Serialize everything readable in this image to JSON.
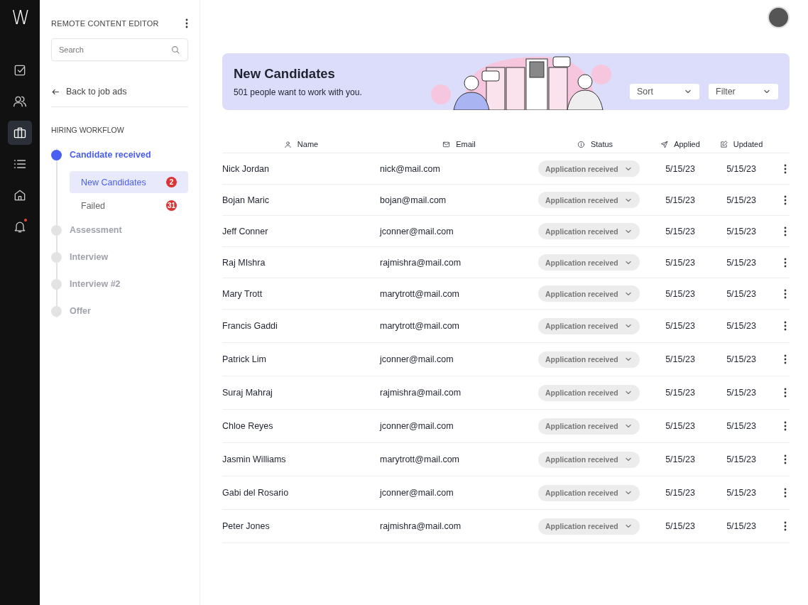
{
  "rail": {
    "logo": "W",
    "items": [
      {
        "kind": "task",
        "selected": false,
        "unread": false
      },
      {
        "kind": "users",
        "selected": false,
        "unread": false
      },
      {
        "kind": "briefcase",
        "selected": true,
        "unread": false
      },
      {
        "kind": "list",
        "selected": false,
        "unread": false
      },
      {
        "kind": "home",
        "selected": false,
        "unread": false
      },
      {
        "kind": "bell",
        "selected": false,
        "unread": true
      }
    ]
  },
  "sidebar": {
    "title": "REMOTE CONTENT EDITOR",
    "search": {
      "placeholder": "Search"
    },
    "back_link": "Back to job ads",
    "section": "HIRING WORKFLOW",
    "steps": [
      {
        "label": "Candidate received",
        "active": true,
        "children": [
          {
            "label": "New Candidates",
            "selected": true,
            "badge": "2"
          },
          {
            "label": "Failed",
            "selected": false,
            "badge": "31"
          }
        ]
      },
      {
        "label": "Assessment",
        "active": false
      },
      {
        "label": "Interview",
        "active": false
      },
      {
        "label": "Interview #2",
        "active": false
      },
      {
        "label": "Offer",
        "active": false
      }
    ]
  },
  "banner": {
    "title": "New Candidates",
    "subtitle": "501 people want to work with you.",
    "sort": "Sort",
    "filter": "Filter"
  },
  "table": {
    "columns": [
      {
        "label": "Name",
        "kind": "user"
      },
      {
        "label": "Email",
        "kind": "mail"
      },
      {
        "label": "Status",
        "kind": "info"
      },
      {
        "label": "Applied",
        "kind": "send"
      },
      {
        "label": "Updated",
        "kind": "edit"
      }
    ],
    "rows": [
      {
        "name": "Nick Jordan",
        "email": "nick@mail.com",
        "status": "Application received",
        "applied": "5/15/23",
        "updated": "5/15/23"
      },
      {
        "name": "Bojan Maric",
        "email": "bojan@mail.com",
        "status": "Application received",
        "applied": "5/15/23",
        "updated": "5/15/23"
      },
      {
        "name": "Jeff Conner",
        "email": "jconner@mail.com",
        "status": "Application received",
        "applied": "5/15/23",
        "updated": "5/15/23"
      },
      {
        "name": "Raj MIshra",
        "email": "rajmishra@mail.com",
        "status": "Application received",
        "applied": "5/15/23",
        "updated": "5/15/23"
      },
      {
        "name": "Mary Trott",
        "email": "marytrott@mail.com",
        "status": "Application received",
        "applied": "5/15/23",
        "updated": "5/15/23"
      },
      {
        "name": "Francis Gaddi",
        "email": "marytrott@mail.com",
        "status": "Application received",
        "applied": "5/15/23",
        "updated": "5/15/23"
      },
      {
        "name": "Patrick Lim",
        "email": "jconner@mail.com",
        "status": "Application received",
        "applied": "5/15/23",
        "updated": "5/15/23"
      },
      {
        "name": "Suraj Mahraj",
        "email": "rajmishra@mail.com",
        "status": "Application received",
        "applied": "5/15/23",
        "updated": "5/15/23"
      },
      {
        "name": "Chloe Reyes",
        "email": "jconner@mail.com",
        "status": "Application received",
        "applied": "5/15/23",
        "updated": "5/15/23"
      },
      {
        "name": "Jasmin Williams",
        "email": "marytrott@mail.com",
        "status": "Application received",
        "applied": "5/15/23",
        "updated": "5/15/23"
      },
      {
        "name": "Gabi del Rosario",
        "email": "jconner@mail.com",
        "status": "Application received",
        "applied": "5/15/23",
        "updated": "5/15/23"
      },
      {
        "name": "Peter Jones",
        "email": "rajmishra@mail.com",
        "status": "Application received",
        "applied": "5/15/23",
        "updated": "5/15/23"
      }
    ]
  }
}
